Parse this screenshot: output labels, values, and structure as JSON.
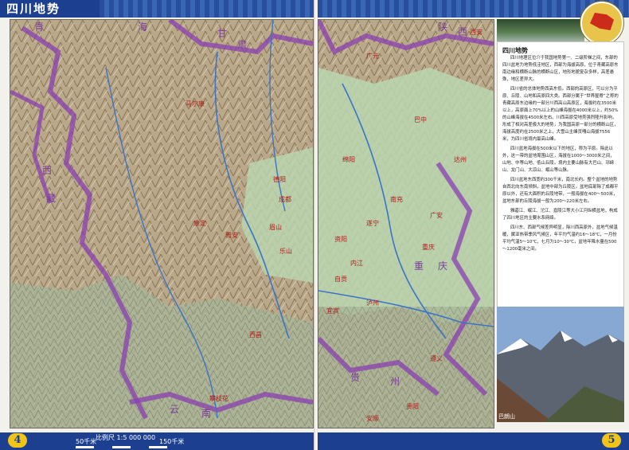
{
  "left_page": {
    "title": "四川地势",
    "page_number": "4",
    "scale_text": "比例尺 1:5 000 000",
    "scale_ticks": [
      "50千米",
      "0",
      "50",
      "100",
      "150千米"
    ]
  },
  "right_page": {
    "page_number": "5",
    "panel_title": "四川地势",
    "panel_paragraphs": [
      "四川地理区位介于我国地势第一、二级阶梯之间，东部的四川盆地为地势低洼地区，西部为海拔高原，位于青藏高原东南边缘和横断山脉的横断山区，地形地貌复杂多样，高差悬殊，地区差异大。",
      "四川省的总体地势西高东低。西部的高原区，可以分为平原、丘陵、山地和高原四大类。西部分属于“世界屋脊”之称的青藏高原东边缘的一部分川西高山高原区，海拔约在3500米以上，高原面上70%以上的山峰海拔在4000米以上，约50%的山峰海拔在4500米左右。川西高原受地壳强烈隆升影响，形成了相对高差极大的地势，为我国高原一部分的横断山区，海拔高度约在2500米之上，大雪山主峰贡嘎山海拔7556米，为四川省境内最高山峰。",
      "四川盆地海拔在500米以下的地区，称为平原。除此以外，这一带的盆地周围山区，海拔在1000～3000米之间，山地、中等山地、低山丘陵。境内主要山脉有大巴山、邛崃山、龙门山、大凉山、岷山等山脉。",
      "四川盆地东西宽约300千米，南北长约。整个盆地的地势自西北向东南倾斜，盆地中部为丘陵区。盆地底部除了成都平原以外，还有大面积的丘陵地带，一般海拔在400～500米，盆地东部的丘陵海拔一般为200～220米左右。",
      "雅砻江、岷江、沱江、嘉陵江等大小江河纵横盆地，构成了四川地区的主要水系网络。",
      "四川东、西部气候差异明显，除川西高原外，盆地气候温暖，属亚热带季风气候区，年平均气温约16～18℃，一月份平均气温5～10℃，七月为10～30℃，盆地年降水量在500～1200毫米之间。"
    ],
    "photo_caption": "巴朗山"
  },
  "map": {
    "big_labels": [
      "青",
      "海",
      "甘",
      "肃",
      "西",
      "藏",
      "云",
      "南",
      "陕",
      "西",
      "重",
      "庆",
      "贵",
      "州"
    ],
    "cities": [
      "成都",
      "绵阳",
      "德阳",
      "南充",
      "遂宁",
      "内江",
      "自贡",
      "宜宾",
      "泸州",
      "乐山",
      "雅安",
      "广元",
      "巴中",
      "达州",
      "广安",
      "资阳",
      "眉山",
      "攀枝花",
      "西昌",
      "康定",
      "马尔康",
      "重庆",
      "遵义",
      "贵阳",
      "安顺",
      "西安"
    ],
    "colors": {
      "border": "#8a3fb2",
      "river": "#3b73c9",
      "plain": "#b9d7b0"
    }
  }
}
